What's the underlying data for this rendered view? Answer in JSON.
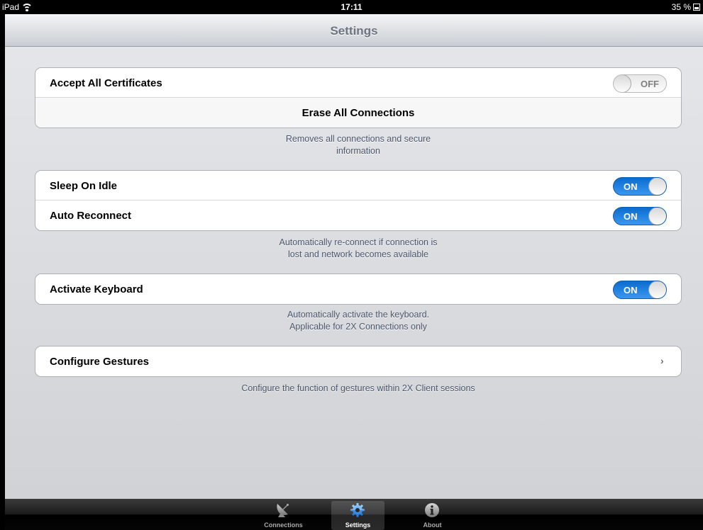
{
  "status_bar": {
    "device": "iPad",
    "time": "17:11",
    "battery": "35 %"
  },
  "navbar": {
    "title": "Settings"
  },
  "group1": {
    "accept_label": "Accept All Certificates",
    "accept_toggle": "OFF",
    "erase_label": "Erase All Connections",
    "footer_line1": "Removes all connections and secure",
    "footer_line2": "information"
  },
  "group2": {
    "sleep_label": "Sleep On Idle",
    "sleep_toggle": "ON",
    "reconnect_label": "Auto Reconnect",
    "reconnect_toggle": "ON",
    "footer_line1": "Automatically re-connect if connection is",
    "footer_line2": "lost and network becomes available"
  },
  "group3": {
    "keyboard_label": "Activate Keyboard",
    "keyboard_toggle": "ON",
    "footer_line1": "Automatically activate the keyboard.",
    "footer_line2": "Applicable for 2X Connections only"
  },
  "group4": {
    "gestures_label": "Configure Gestures",
    "footer": "Configure the function of gestures within 2X Client sessions"
  },
  "tabbar": {
    "tabs": [
      {
        "label": "Connections",
        "icon": "satellite-dish-icon",
        "active": false
      },
      {
        "label": "Settings",
        "icon": "gear-icon",
        "active": true
      },
      {
        "label": "About",
        "icon": "info-icon",
        "active": false
      }
    ]
  },
  "colors": {
    "toggle_on": "#1a7ee0",
    "background": "#dcdde0",
    "footer_text": "#4c566c"
  }
}
